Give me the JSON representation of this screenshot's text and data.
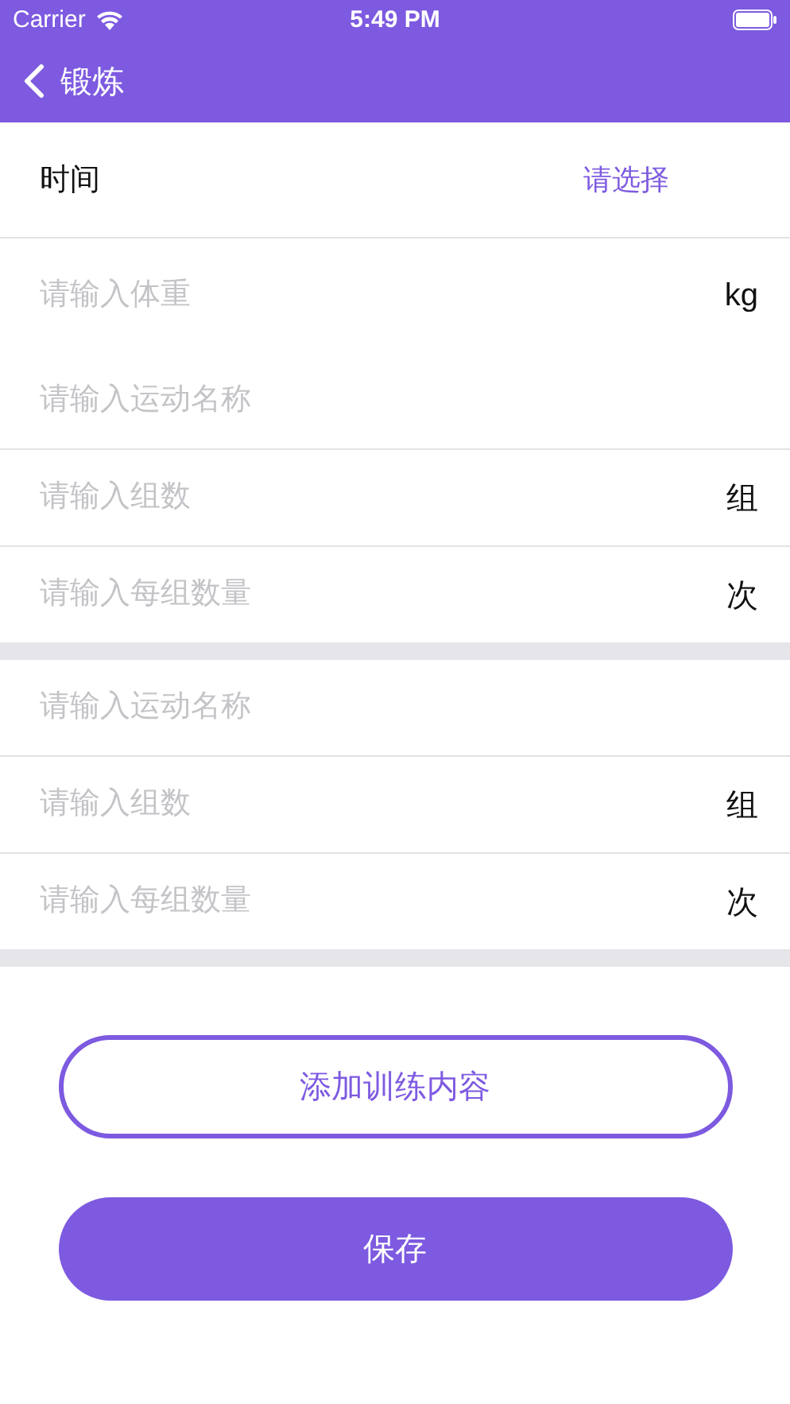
{
  "status_bar": {
    "carrier": "Carrier",
    "time": "5:49 PM"
  },
  "nav": {
    "title": "锻炼"
  },
  "time_row": {
    "label": "时间",
    "value": "请选择"
  },
  "weight": {
    "placeholder": "请输入体重",
    "unit": "kg"
  },
  "sections": [
    {
      "fields": [
        {
          "placeholder": "请输入运动名称"
        },
        {
          "placeholder": "请输入组数",
          "unit": "组"
        },
        {
          "placeholder": "请输入每组数量",
          "unit": "次"
        }
      ]
    },
    {
      "fields": [
        {
          "placeholder": "请输入运动名称"
        },
        {
          "placeholder": "请输入组数",
          "unit": "组"
        },
        {
          "placeholder": "请输入每组数量",
          "unit": "次"
        }
      ]
    }
  ],
  "buttons": [
    {
      "label": "添加训练内容",
      "kind": "outline"
    },
    {
      "label": "保存",
      "kind": "filled"
    }
  ]
}
